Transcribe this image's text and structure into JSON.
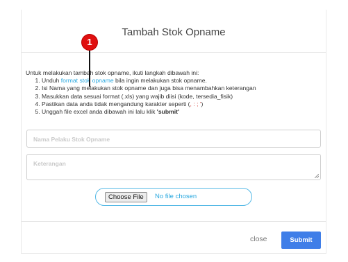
{
  "modal": {
    "title": "Tambah Stok Opname"
  },
  "callout": {
    "number": "1"
  },
  "instructions": {
    "intro": "Untuk melakukan tambah stok opname, ikuti langkah dibawah ini:",
    "step1_prefix": "Unduh ",
    "step1_link": "format stok opname",
    "step1_suffix": " bila ingin melakukan stok opname.",
    "step2": "Isi Nama yang melakukan stok opname dan juga bisa menambahkan keterangan",
    "step3": "Masukkan data sesuai format (.xls) yang wajib diisi (kode, tersedia_fisik)",
    "step4_prefix": "Pastikan data anda tidak mengandung karakter seperti (",
    "step4_chars": ", : ; '",
    "step4_suffix": ")",
    "step5_prefix": "Unggah file excel anda dibawah ini lalu klik ",
    "step5_bold": "'submit'"
  },
  "form": {
    "name_placeholder": "Nama Pelaku Stok Opname",
    "notes_placeholder": "Keterangan",
    "choose_file_label": "Choose File",
    "no_file_text": "No file chosen"
  },
  "footer": {
    "close_label": "close",
    "submit_label": "Submit"
  },
  "colors": {
    "link": "#29a8df",
    "submit": "#3f7ee8",
    "callout": "#e01010"
  }
}
